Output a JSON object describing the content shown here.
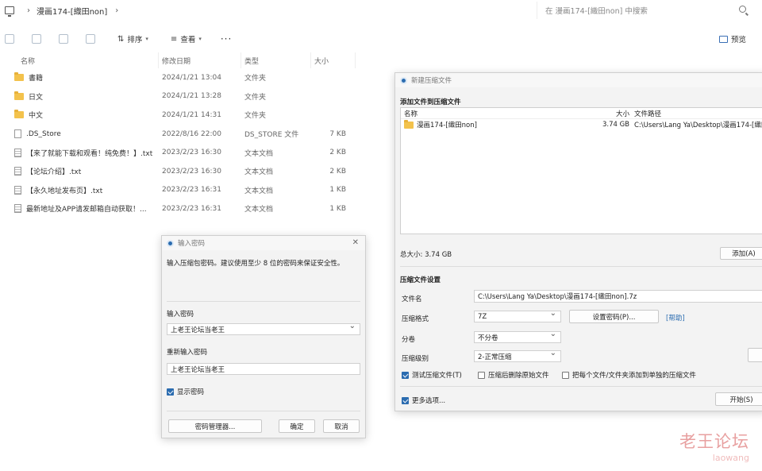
{
  "explorer": {
    "breadcrumb": "漫画174-[織田non]",
    "search_placeholder": "在 漫画174-[織田non] 中搜索",
    "toolbar": {
      "sort": "排序",
      "view": "查看",
      "more": "···",
      "preview": "预览"
    },
    "columns": {
      "name": "名称",
      "date": "修改日期",
      "type": "类型",
      "size": "大小"
    },
    "files": [
      {
        "icon": "folder",
        "name": "書籍",
        "date": "2024/1/21 13:04",
        "type": "文件夹",
        "size": ""
      },
      {
        "icon": "folder",
        "name": "日文",
        "date": "2024/1/21 13:28",
        "type": "文件夹",
        "size": ""
      },
      {
        "icon": "folder",
        "name": "中文",
        "date": "2024/1/21 14:31",
        "type": "文件夹",
        "size": ""
      },
      {
        "icon": "file",
        "name": ".DS_Store",
        "date": "2022/8/16 22:00",
        "type": "DS_STORE 文件",
        "size": "7 KB"
      },
      {
        "icon": "text",
        "name": "【来了就能下载和观看！纯免费！】.txt",
        "date": "2023/2/23 16:30",
        "type": "文本文档",
        "size": "2 KB"
      },
      {
        "icon": "text",
        "name": "【论坛介绍】.txt",
        "date": "2023/2/23 16:30",
        "type": "文本文档",
        "size": "2 KB"
      },
      {
        "icon": "text",
        "name": "【永久地址发布页】.txt",
        "date": "2023/2/23 16:31",
        "type": "文本文档",
        "size": "1 KB"
      },
      {
        "icon": "text",
        "name": "最新地址及APP请发邮箱自动获取！...",
        "date": "2023/2/23 16:31",
        "type": "文本文档",
        "size": "1 KB"
      }
    ]
  },
  "password_dialog": {
    "title": "输入密码",
    "message": "输入压缩包密码。建议使用至少 8 位的密码来保证安全性。",
    "label_password": "输入密码",
    "password_value": "上老王论坛当老王",
    "label_confirm": "重新输入密码",
    "confirm_value": "上老王论坛当老王",
    "show_password": "显示密码",
    "btn_manager": "密码管理器...",
    "btn_ok": "确定",
    "btn_cancel": "取消"
  },
  "archive_dialog": {
    "title": "新建压缩文件",
    "add_section": "添加文件到压缩文件",
    "col_name": "名称",
    "col_size": "大小",
    "col_path": "文件路径",
    "item_name": "漫画174-[織田non]",
    "item_size": "3.74 GB",
    "item_path": "C:\\Users\\Lang Ya\\Desktop\\漫画174-[織田",
    "total_size": "总大小: 3.74 GB",
    "btn_add": "添加(A)",
    "settings_section": "压缩文件设置",
    "label_filename": "文件名",
    "filename_value": "C:\\Users\\Lang Ya\\Desktop\\漫画174-[織田non].7z",
    "label_format": "压缩格式",
    "format_value": "7Z",
    "btn_set_password": "设置密码(P)...",
    "help": "[帮助]",
    "label_split": "分卷",
    "split_value": "不分卷",
    "label_level": "压缩级别",
    "level_value": "2-正常压缩",
    "cb_test": "测试压缩文件(T)",
    "cb_delete": "压缩后删除原始文件",
    "cb_each": "把每个文件/文件夹添加到单独的压缩文件",
    "cb_more": "更多选项...",
    "btn_start": "开始(S)"
  },
  "watermark": {
    "main": "老王论坛",
    "sub": "laowang"
  }
}
